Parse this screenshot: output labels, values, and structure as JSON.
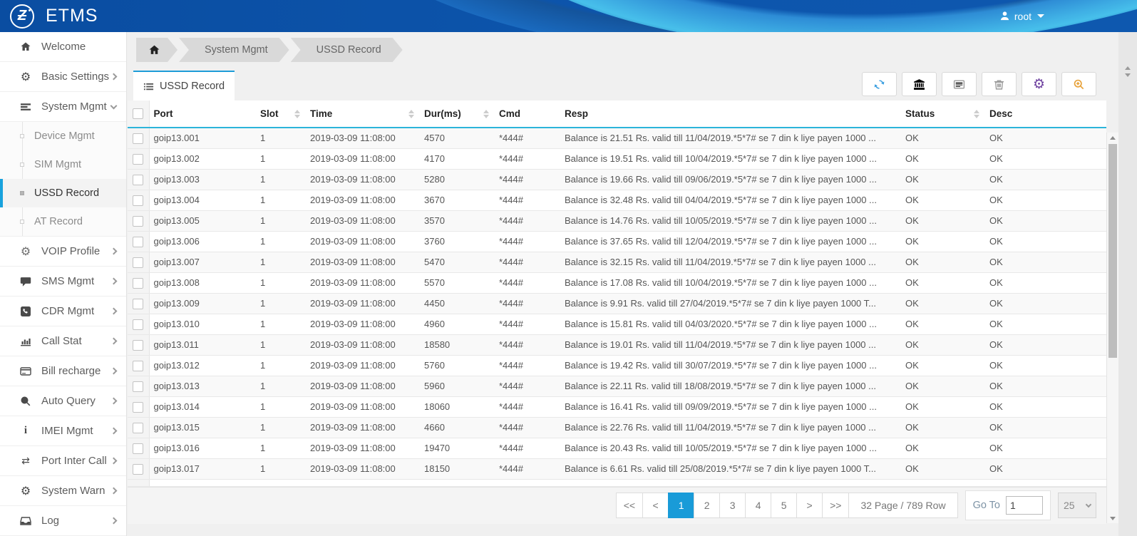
{
  "header": {
    "title": "ETMS",
    "user": "root",
    "accent_blue": "#0d55ac"
  },
  "sidebar": {
    "items": [
      {
        "label": "Welcome",
        "icon": "home-icon",
        "chevron": null
      },
      {
        "label": "Basic Settings",
        "icon": "gear-icon",
        "chevron": "right"
      },
      {
        "label": "System Mgmt",
        "icon": "menu-icon",
        "chevron": "down",
        "expanded": true,
        "children": [
          {
            "label": "Device Mgmt",
            "active": false
          },
          {
            "label": "SIM Mgmt",
            "active": false
          },
          {
            "label": "USSD Record",
            "active": true
          },
          {
            "label": "AT Record",
            "active": false
          }
        ]
      },
      {
        "label": "VOIP Profile",
        "icon": "gear-outline-icon",
        "chevron": "right"
      },
      {
        "label": "SMS Mgmt",
        "icon": "chat-icon",
        "chevron": "right"
      },
      {
        "label": "CDR Mgmt",
        "icon": "phone-icon",
        "chevron": "right"
      },
      {
        "label": "Call Stat",
        "icon": "bar-chart-icon",
        "chevron": "right"
      },
      {
        "label": "Bill recharge",
        "icon": "credit-card-icon",
        "chevron": "right"
      },
      {
        "label": "Auto Query",
        "icon": "search-icon",
        "chevron": "right"
      },
      {
        "label": "IMEI Mgmt",
        "icon": "info-icon",
        "chevron": "right"
      },
      {
        "label": "Port Inter Call",
        "icon": "swap-icon",
        "chevron": "right"
      },
      {
        "label": "System Warn",
        "icon": "gear-icon",
        "chevron": "right"
      },
      {
        "label": "Log",
        "icon": "inbox-icon",
        "chevron": "right"
      }
    ]
  },
  "breadcrumb": {
    "items": [
      "System Mgmt",
      "USSD Record"
    ]
  },
  "tab": {
    "label": "USSD Record",
    "icon": "list-icon",
    "active_color": "#1e9cd7"
  },
  "toolbar": {
    "buttons": [
      {
        "name": "refresh-button",
        "icon": "refresh-icon",
        "color": "#3b9fe0"
      },
      {
        "name": "bank-button",
        "icon": "bank-icon",
        "color": "#d43f3a"
      },
      {
        "name": "card-view-button",
        "icon": "card-icon",
        "color": "#9a9a9a"
      },
      {
        "name": "delete-button",
        "icon": "trash-icon",
        "color": "#9a9a9a"
      },
      {
        "name": "settings-button",
        "icon": "gear-icon",
        "color": "#6f42a0"
      },
      {
        "name": "search-button",
        "icon": "zoom-in-icon",
        "color": "#e8a33d"
      }
    ]
  },
  "table": {
    "columns": [
      {
        "key": "port",
        "label": "Port",
        "sortable": false
      },
      {
        "key": "slot",
        "label": "Slot",
        "sortable": true
      },
      {
        "key": "time",
        "label": "Time",
        "sortable": true
      },
      {
        "key": "dur",
        "label": "Dur(ms)",
        "sortable": true
      },
      {
        "key": "cmd",
        "label": "Cmd",
        "sortable": false
      },
      {
        "key": "resp",
        "label": "Resp",
        "sortable": false
      },
      {
        "key": "status",
        "label": "Status",
        "sortable": true
      },
      {
        "key": "desc",
        "label": "Desc",
        "sortable": false
      }
    ],
    "rows": [
      {
        "port": "goip13.001",
        "slot": "1",
        "time": "2019-03-09 11:08:00",
        "dur": "4570",
        "cmd": "*444#",
        "resp": "Balance is 21.51 Rs. valid till 11/04/2019.*5*7# se 7 din k liye payen 1000 ...",
        "status": "OK",
        "desc": "OK"
      },
      {
        "port": "goip13.002",
        "slot": "1",
        "time": "2019-03-09 11:08:00",
        "dur": "4170",
        "cmd": "*444#",
        "resp": "Balance is 19.51 Rs. valid till 10/04/2019.*5*7# se 7 din k liye payen 1000 ...",
        "status": "OK",
        "desc": "OK"
      },
      {
        "port": "goip13.003",
        "slot": "1",
        "time": "2019-03-09 11:08:00",
        "dur": "5280",
        "cmd": "*444#",
        "resp": "Balance is 19.66 Rs. valid till 09/06/2019.*5*7# se 7 din k liye payen 1000 ...",
        "status": "OK",
        "desc": "OK"
      },
      {
        "port": "goip13.004",
        "slot": "1",
        "time": "2019-03-09 11:08:00",
        "dur": "3670",
        "cmd": "*444#",
        "resp": "Balance is 32.48 Rs. valid till 04/04/2019.*5*7# se 7 din k liye payen 1000 ...",
        "status": "OK",
        "desc": "OK"
      },
      {
        "port": "goip13.005",
        "slot": "1",
        "time": "2019-03-09 11:08:00",
        "dur": "3570",
        "cmd": "*444#",
        "resp": "Balance is 14.76 Rs. valid till 10/05/2019.*5*7# se 7 din k liye payen 1000 ...",
        "status": "OK",
        "desc": "OK"
      },
      {
        "port": "goip13.006",
        "slot": "1",
        "time": "2019-03-09 11:08:00",
        "dur": "3760",
        "cmd": "*444#",
        "resp": "Balance is 37.65 Rs. valid till 12/04/2019.*5*7# se 7 din k liye payen 1000 ...",
        "status": "OK",
        "desc": "OK"
      },
      {
        "port": "goip13.007",
        "slot": "1",
        "time": "2019-03-09 11:08:00",
        "dur": "5470",
        "cmd": "*444#",
        "resp": "Balance is 32.15 Rs. valid till 11/04/2019.*5*7# se 7 din k liye payen 1000 ...",
        "status": "OK",
        "desc": "OK"
      },
      {
        "port": "goip13.008",
        "slot": "1",
        "time": "2019-03-09 11:08:00",
        "dur": "5570",
        "cmd": "*444#",
        "resp": "Balance is 17.08 Rs. valid till 10/04/2019.*5*7# se 7 din k liye payen 1000 ...",
        "status": "OK",
        "desc": "OK"
      },
      {
        "port": "goip13.009",
        "slot": "1",
        "time": "2019-03-09 11:08:00",
        "dur": "4450",
        "cmd": "*444#",
        "resp": "Balance is 9.91 Rs. valid till 27/04/2019.*5*7# se 7 din k liye payen 1000 T...",
        "status": "OK",
        "desc": "OK"
      },
      {
        "port": "goip13.010",
        "slot": "1",
        "time": "2019-03-09 11:08:00",
        "dur": "4960",
        "cmd": "*444#",
        "resp": "Balance is 15.81 Rs. valid till 04/03/2020.*5*7# se 7 din k liye payen 1000 ...",
        "status": "OK",
        "desc": "OK"
      },
      {
        "port": "goip13.011",
        "slot": "1",
        "time": "2019-03-09 11:08:00",
        "dur": "18580",
        "cmd": "*444#",
        "resp": "Balance is 19.01 Rs. valid till 11/04/2019.*5*7# se 7 din k liye payen 1000 ...",
        "status": "OK",
        "desc": "OK"
      },
      {
        "port": "goip13.012",
        "slot": "1",
        "time": "2019-03-09 11:08:00",
        "dur": "5760",
        "cmd": "*444#",
        "resp": "Balance is 19.42 Rs. valid till 30/07/2019.*5*7# se 7 din k liye payen 1000 ...",
        "status": "OK",
        "desc": "OK"
      },
      {
        "port": "goip13.013",
        "slot": "1",
        "time": "2019-03-09 11:08:00",
        "dur": "5960",
        "cmd": "*444#",
        "resp": "Balance is 22.11 Rs. valid till 18/08/2019.*5*7# se 7 din k liye payen 1000 ...",
        "status": "OK",
        "desc": "OK"
      },
      {
        "port": "goip13.014",
        "slot": "1",
        "time": "2019-03-09 11:08:00",
        "dur": "18060",
        "cmd": "*444#",
        "resp": "Balance is 16.41 Rs. valid till 09/09/2019.*5*7# se 7 din k liye payen 1000 ...",
        "status": "OK",
        "desc": "OK"
      },
      {
        "port": "goip13.015",
        "slot": "1",
        "time": "2019-03-09 11:08:00",
        "dur": "4660",
        "cmd": "*444#",
        "resp": "Balance is 22.76 Rs. valid till 11/04/2019.*5*7# se 7 din k liye payen 1000 ...",
        "status": "OK",
        "desc": "OK"
      },
      {
        "port": "goip13.016",
        "slot": "1",
        "time": "2019-03-09 11:08:00",
        "dur": "19470",
        "cmd": "*444#",
        "resp": "Balance is 20.43 Rs. valid till 10/05/2019.*5*7# se 7 din k liye payen 1000 ...",
        "status": "OK",
        "desc": "OK"
      },
      {
        "port": "goip13.017",
        "slot": "1",
        "time": "2019-03-09 11:08:00",
        "dur": "18150",
        "cmd": "*444#",
        "resp": "Balance is 6.61 Rs. valid till 25/08/2019.*5*7# se 7 din k liye payen 1000 T...",
        "status": "OK",
        "desc": "OK"
      }
    ]
  },
  "pagination": {
    "buttons": [
      "<<",
      "<",
      "1",
      "2",
      "3",
      "4",
      "5",
      ">",
      ">>"
    ],
    "active": "1",
    "summary": "32 Page / 789 Row",
    "goto_label": "Go To",
    "goto_value": "1",
    "page_size": "25",
    "active_color": "#199bd8"
  }
}
